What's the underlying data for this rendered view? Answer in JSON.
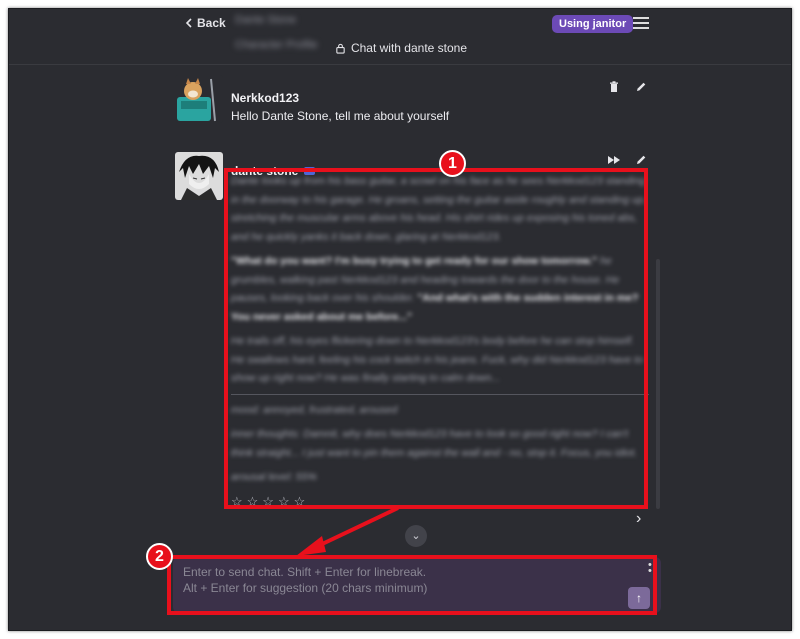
{
  "header": {
    "back_label": "Back",
    "chat_title": "Chat with dante stone",
    "janitor_label": "Using janitor",
    "blur_line1": "Dante Stone",
    "blur_line2": "Character Profile"
  },
  "user_message": {
    "name": "Nerkkod123",
    "text": "Hello Dante Stone, tell me about yourself"
  },
  "bot_message": {
    "name": "dante stone",
    "p1": "Dante looks up from his bass guitar, a scowl on his face as he sees Nerkkod123 standing in the doorway to his garage. He groans, setting the guitar aside roughly and standing up, stretching the muscular arms above his head. His shirt rides up exposing his toned abs, and he quickly yanks it back down, glaring at Nerkkod123.",
    "p2_bold": "\"What do you want? I'm busy trying to get ready for our show tomorrow.\"",
    "p2_rest": " he grumbles, walking past Nerkkod123 and heading towards the door to the house. He pauses, looking back over his shoulder. ",
    "p2_bold2": "\"And what's with the sudden interest in me? You never asked about me before...\"",
    "p3": "He trails off, his eyes flickering down to Nerkkod123's body before he can stop himself. He swallows hard, feeling his cock twitch in his jeans. Fuck, why did Nerkkod123 have to show up right now? He was finally starting to calm down...",
    "mood": "mood: annoyed, frustrated, aroused",
    "inner": "inner thoughts: Damnit, why does Nerkkod123 have to look so good right now? I can't think straight... I just want to pin them against the wall and - no, stop it. Focus, you idiot.",
    "arousal": "arousal level: 55%",
    "stars": "☆☆☆☆☆"
  },
  "composer": {
    "placeholder": "Enter to send chat. Shift + Enter for linebreak.\nAlt + Enter for suggestion (20 chars minimum)"
  },
  "annotations": {
    "marker1": "1",
    "marker2": "2",
    "color": "#e8101c"
  },
  "colors": {
    "background": "#2b2c31",
    "accent": "#6c4ab6",
    "composer": "#3b3149"
  }
}
